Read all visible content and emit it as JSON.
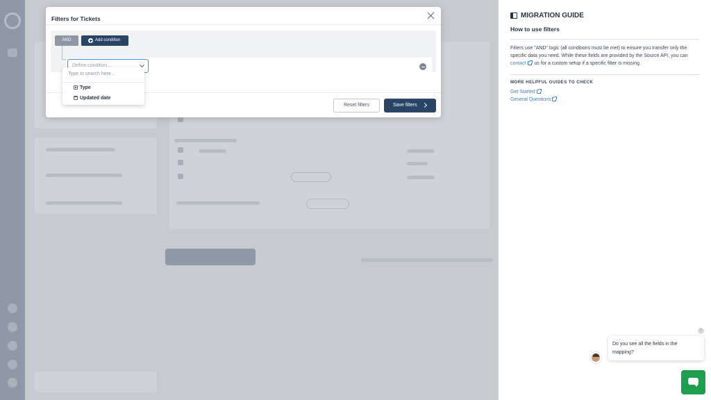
{
  "modal": {
    "title": "Filters for Tickets",
    "and_label": "AND",
    "add_condition_label": "Add condition",
    "condition_placeholder": "Define condition...",
    "reset_label": "Reset filters",
    "save_label": "Save filters"
  },
  "dropdown": {
    "search_placeholder": "Type to search here...",
    "items": [
      {
        "label": "Type",
        "icon": "tag-icon"
      },
      {
        "label": "Updated date",
        "icon": "calendar-icon"
      }
    ]
  },
  "guide": {
    "title": "MIGRATION GUIDE",
    "subtitle": "How to use filters",
    "text_before_link": "Filters use \"AND\" logic (all conditions must be met) to ensure you transfer only the specific data you need. While these fields are provided by the Source API, you can",
    "contact_link": "contact",
    "text_after_link": "us for a custom setup if a specific filter is missing.",
    "more_heading": "MORE HELPFUL GUIDES TO CHECK",
    "links": [
      "Get Started",
      "General Questions"
    ]
  },
  "chat": {
    "message": "Do you see all the fields in the mapping?",
    "close_glyph": "×"
  },
  "colors": {
    "primary": "#2a4466",
    "link": "#3a83c6",
    "chat_green": "#1e9e4c",
    "and_badge": "#8e97a6"
  }
}
